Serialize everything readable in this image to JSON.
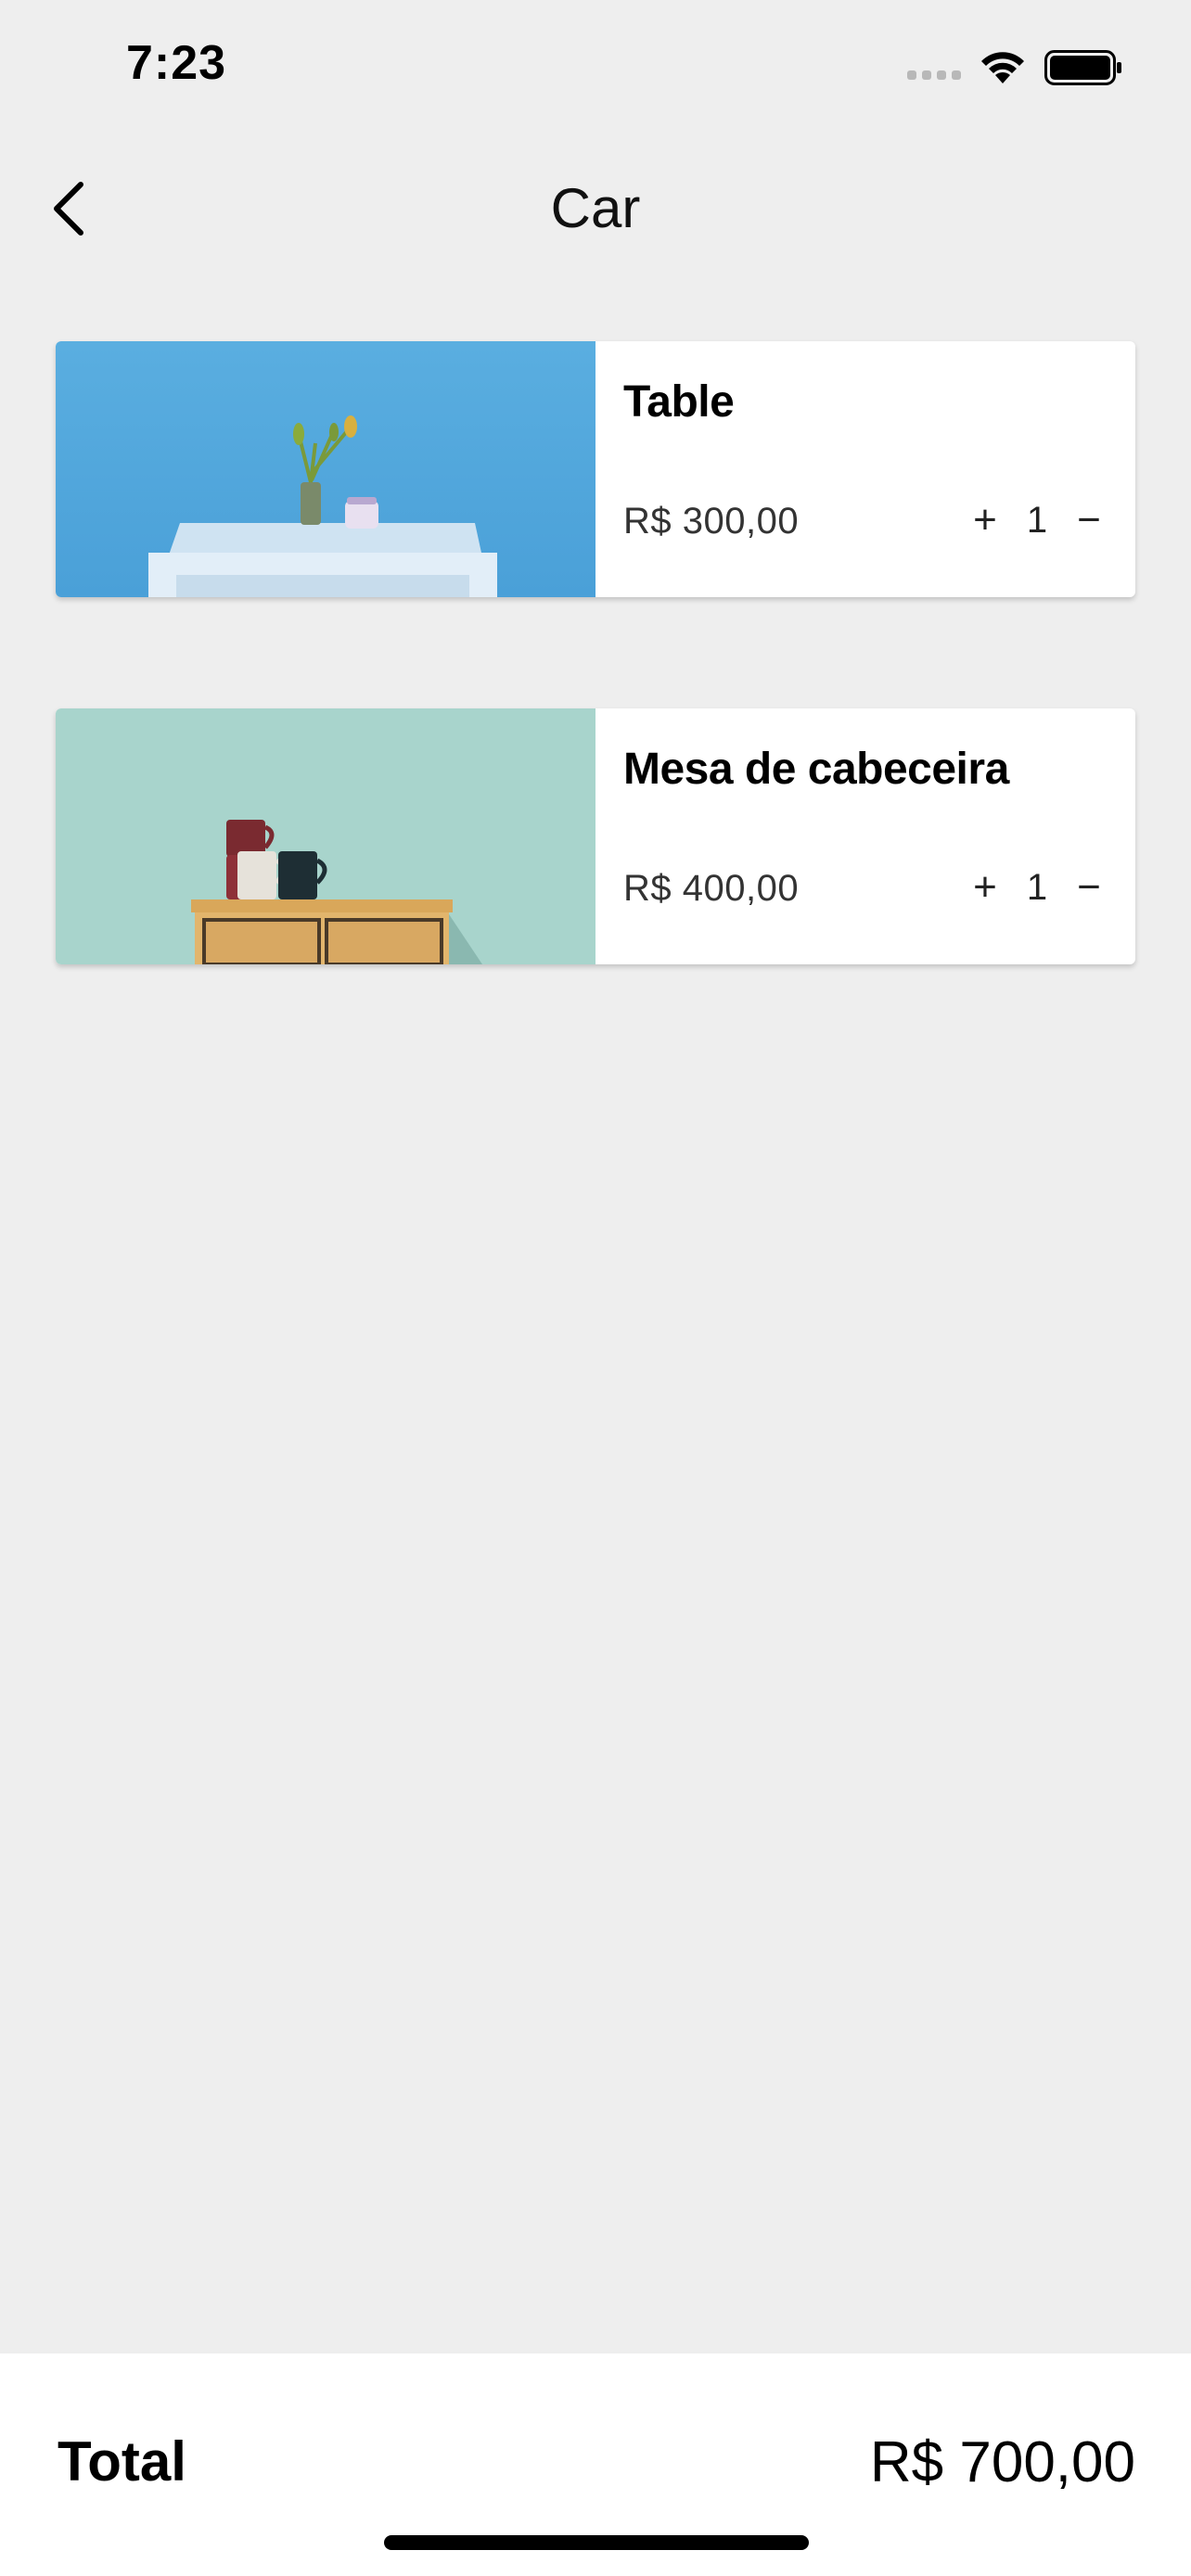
{
  "status_bar": {
    "time": "7:23"
  },
  "nav": {
    "title": "Car",
    "back_icon": "chevron-left-icon"
  },
  "cart": {
    "items": [
      {
        "name": "Table",
        "price": "R$ 300,00",
        "quantity": "1",
        "increment_label": "+",
        "decrement_label": "−",
        "image": "white table with plant vase and jar on blue wall"
      },
      {
        "name": "Mesa de cabeceira",
        "price": "R$ 400,00",
        "quantity": "1",
        "increment_label": "+",
        "decrement_label": "−",
        "image": "wooden nightstand with three mugs on mint wall"
      }
    ]
  },
  "footer": {
    "total_label": "Total",
    "total_value": "R$ 700,00"
  },
  "colors": {
    "background": "#eeeeee",
    "card": "#ffffff",
    "text": "#000000"
  }
}
